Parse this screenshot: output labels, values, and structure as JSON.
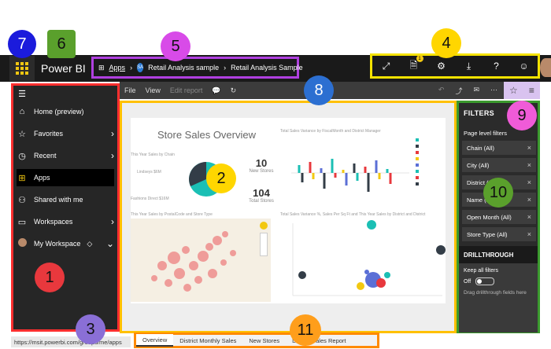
{
  "callouts": [
    "1",
    "2",
    "3",
    "4",
    "5",
    "6",
    "7",
    "8",
    "9",
    "10",
    "11"
  ],
  "header": {
    "brand": "Power BI",
    "breadcrumb": {
      "apps": "Apps",
      "badge": "SA",
      "workspace": "Retail Analysis sample",
      "report": "Retail Analysis Sample"
    },
    "notification_count": "1"
  },
  "menubar": {
    "file": "File",
    "view": "View",
    "edit_report": "Edit report"
  },
  "sidebar": {
    "items": [
      {
        "label": "Home (preview)",
        "icon": "home-icon"
      },
      {
        "label": "Favorites",
        "icon": "star-icon"
      },
      {
        "label": "Recent",
        "icon": "clock-icon"
      },
      {
        "label": "Apps",
        "icon": "apps-icon"
      },
      {
        "label": "Shared with me",
        "icon": "shared-icon"
      },
      {
        "label": "Workspaces",
        "icon": "workspaces-icon"
      },
      {
        "label": "My Workspace",
        "icon": "avatar"
      }
    ]
  },
  "report": {
    "title": "Store Sales Overview",
    "kpi1_value": "10",
    "kpi1_label": "New Stores",
    "kpi2_value": "104",
    "kpi2_label": "Total Stores",
    "chart1_caption": "This Year Sales by Chain",
    "chart2_caption": "Total Sales Variance by FiscalMonth and District Manager",
    "chart3_caption": "This Year Sales by PostalCode and Store Type",
    "chart4_caption": "Total Sales Variance %, Sales Per Sq Ft and This Year Sales by District and District",
    "pie_label1": "Lindseys $6M",
    "pie_label2": "Fashions Direct $16M"
  },
  "filters": {
    "title": "FILTERS",
    "page_level": "Page level filters",
    "chips": [
      "Chain (All)",
      "City (All)",
      "District (All)",
      "Name (All)",
      "Open Month (All)",
      "Store Type (All)"
    ],
    "drillthrough_title": "DRILLTHROUGH",
    "keep_all": "Keep all filters",
    "toggle_state": "Off",
    "drag_hint": "Drag drillthrough fields here"
  },
  "status_url": "https://msit.powerbi.com/groups/me/apps",
  "tabs": [
    "Overview",
    "District Monthly Sales",
    "New Stores",
    "District Sales Report"
  ],
  "colors": {
    "callout_red": "#e8383d",
    "callout_yellow": "#ffd600",
    "callout_purple": "#8a6fd6",
    "callout_green": "#5aa02c",
    "callout_violet": "#d84be8",
    "callout_blue": "#2c6fd1",
    "callout_navy": "#1b1bdc",
    "callout_orange": "#ff9e1b",
    "pie_teal": "#1bbfb4",
    "pie_dark": "#333d47"
  }
}
